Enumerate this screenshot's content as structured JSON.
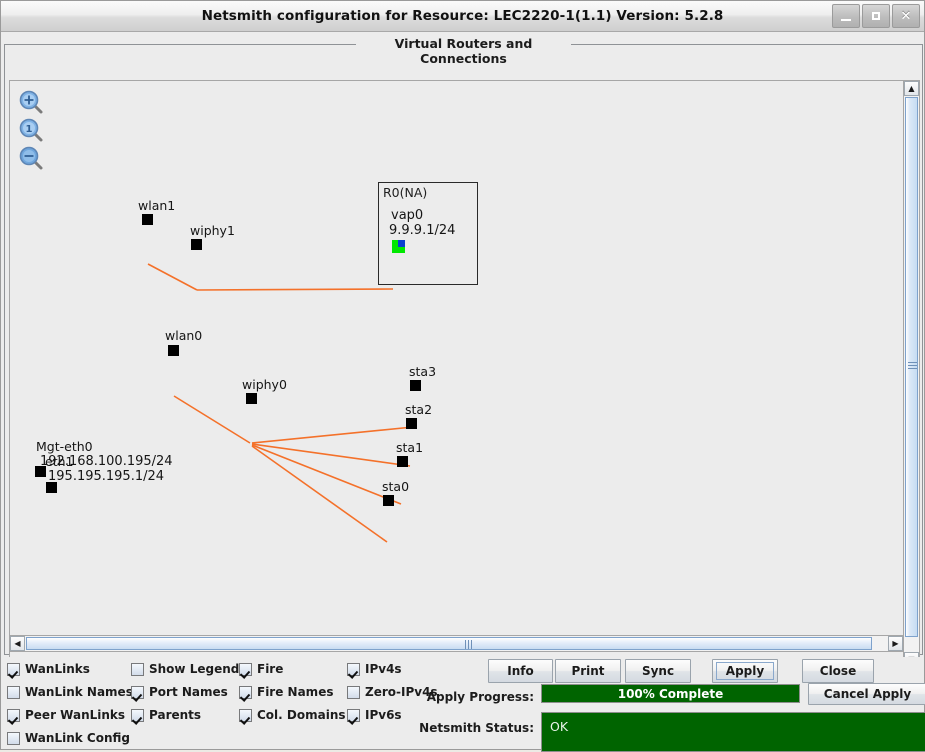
{
  "window": {
    "title": "Netsmith configuration for Resource:  LEC2220-1(1.1)  Version: 5.2.8",
    "minimize_icon": "minimize-icon",
    "maximize_icon": "maximize-icon",
    "close_icon": "close-icon"
  },
  "panel": {
    "title": "Virtual Routers and Connections"
  },
  "toolbar": {
    "zoom_in": "zoom-in-icon",
    "zoom_reset": "zoom-reset-icon",
    "zoom_out": "zoom-out-icon"
  },
  "canvas": {
    "router": {
      "name": "R0(NA)",
      "port_label_line1": "vap0",
      "port_label_line2": "9.9.9.1/24"
    },
    "nodes": [
      {
        "label": "wlan1"
      },
      {
        "label": "wiphy1"
      },
      {
        "label": "wlan0"
      },
      {
        "label": "wiphy0"
      },
      {
        "label": "sta3"
      },
      {
        "label": "sta2"
      },
      {
        "label": "sta1"
      },
      {
        "label": "sta0"
      }
    ],
    "mgt": {
      "name": "Mgt-eth0",
      "ip_a": "192.168.100.195/24",
      "overlay_name": "eth1",
      "ip_b": "195.195.195.1/24"
    }
  },
  "checkboxes": [
    {
      "label": "WanLinks",
      "checked": true
    },
    {
      "label": "WanLink Names",
      "checked": false
    },
    {
      "label": "Peer WanLinks",
      "checked": true
    },
    {
      "label": "WanLink Config",
      "checked": false
    },
    {
      "label": "Show Legend",
      "checked": false
    },
    {
      "label": "Port Names",
      "checked": true
    },
    {
      "label": "Parents",
      "checked": true
    },
    {
      "label": "Fire",
      "checked": true
    },
    {
      "label": "Fire Names",
      "checked": true
    },
    {
      "label": "Col. Domains",
      "checked": true
    },
    {
      "label": "IPv4s",
      "checked": true
    },
    {
      "label": "Zero-IPv4s",
      "checked": false
    },
    {
      "label": "IPv6s",
      "checked": false
    }
  ],
  "buttons": {
    "info": "Info",
    "print": "Print",
    "sync": "Sync",
    "apply": "Apply",
    "close": "Close",
    "cancel_apply": "Cancel Apply"
  },
  "status": {
    "apply_progress_label": "Apply Progress:",
    "apply_progress_value": "100% Complete",
    "netsmith_status_label": "Netsmith Status:",
    "netsmith_status_value": "OK"
  },
  "colors": {
    "link": "#f4712a",
    "port_green": "#00e800",
    "port_blue": "#0b3fd0",
    "progress_green": "#006400",
    "node_black": "#000000"
  }
}
